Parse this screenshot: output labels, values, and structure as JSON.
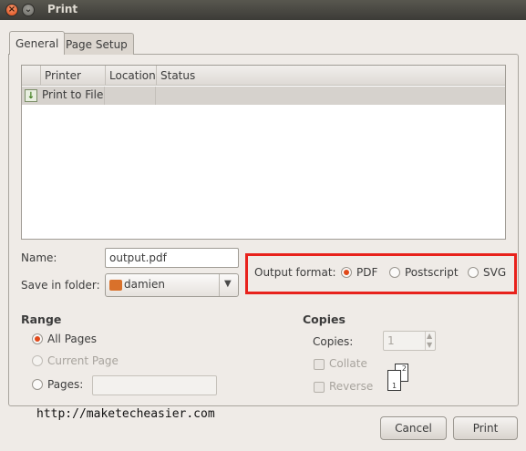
{
  "window": {
    "title": "Print"
  },
  "tabs": [
    {
      "label": "General"
    },
    {
      "label": "Page Setup"
    }
  ],
  "printer_list": {
    "columns": [
      "Printer",
      "Location",
      "Status"
    ],
    "rows": [
      {
        "name": "Print to File",
        "location": "",
        "status": ""
      }
    ]
  },
  "file": {
    "name_label": "Name:",
    "name_value": "output.pdf",
    "folder_label": "Save in folder:",
    "folder_value": "damien",
    "output_format_label": "Output format:",
    "formats": [
      {
        "label": "PDF",
        "selected": true
      },
      {
        "label": "Postscript",
        "selected": false
      },
      {
        "label": "SVG",
        "selected": false
      }
    ]
  },
  "range": {
    "title": "Range",
    "all_pages": "All Pages",
    "current_page": "Current Page",
    "pages": "Pages:",
    "pages_value": ""
  },
  "copies": {
    "title": "Copies",
    "copies_label": "Copies:",
    "copies_value": "1",
    "collate": "Collate",
    "reverse": "Reverse",
    "page_icon_numbers": [
      "1",
      "2"
    ]
  },
  "watermark": "http://maketecheasier.com",
  "buttons": {
    "cancel": "Cancel",
    "print": "Print"
  },
  "colors": {
    "accent": "#e0491a",
    "highlight_box": "#e8221c"
  }
}
